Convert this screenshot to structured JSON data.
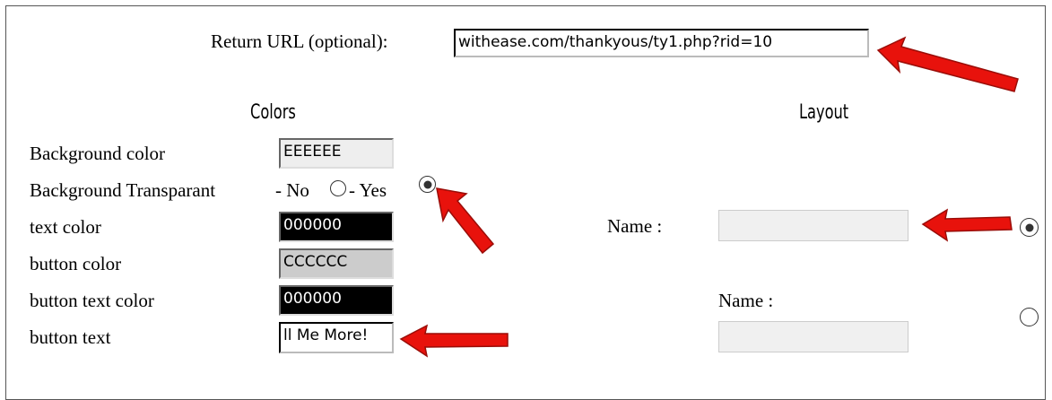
{
  "return_url": {
    "label": "Return URL (optional):",
    "value": "withease.com/thankyous/ty1.php?rid=10"
  },
  "colors": {
    "heading": "Colors",
    "background_color": {
      "label": "Background color",
      "value": "EEEEEE",
      "bg": "#EEEEEE",
      "fg": "#000000"
    },
    "background_transparant": {
      "label": "Background Transparant",
      "no_label": "- No",
      "yes_label": "- Yes",
      "selected": "yes"
    },
    "text_color": {
      "label": "text color",
      "value": "000000",
      "bg": "#000000",
      "fg": "#FFFFFF"
    },
    "button_color": {
      "label": "button color",
      "value": "CCCCCC",
      "bg": "#CCCCCC",
      "fg": "#000000"
    },
    "button_text_color": {
      "label": "button text color",
      "value": "000000",
      "bg": "#000000",
      "fg": "#FFFFFF"
    },
    "button_text": {
      "label": "button text",
      "value": "ll Me More!"
    }
  },
  "layout": {
    "heading": "Layout",
    "option1": {
      "name_label": "Name :",
      "name_value": "",
      "selected": true
    },
    "option2": {
      "name_label": "Name :",
      "name_value": "",
      "selected": false
    }
  },
  "annotation_color": "#E8120C"
}
